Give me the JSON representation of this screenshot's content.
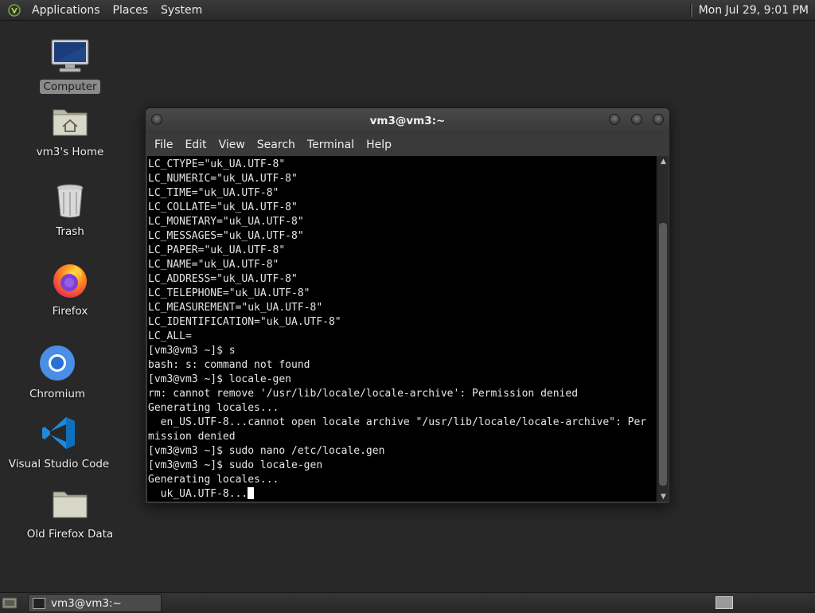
{
  "top_panel": {
    "menus": [
      "Applications",
      "Places",
      "System"
    ],
    "clock": "Mon Jul 29,  9:01 PM"
  },
  "desktop": {
    "icons": [
      {
        "label": "Computer",
        "icon": "computer-icon",
        "selected": true
      },
      {
        "label": "vm3's Home",
        "icon": "home-folder-icon"
      },
      {
        "label": "Trash",
        "icon": "trash-icon"
      },
      {
        "label": "Firefox",
        "icon": "firefox-icon"
      },
      {
        "label": "Chromium",
        "icon": "chromium-icon"
      },
      {
        "label": "Visual Studio Code",
        "icon": "vscode-icon"
      },
      {
        "label": "Old Firefox Data",
        "icon": "folder-icon"
      }
    ]
  },
  "terminal": {
    "title": "vm3@vm3:~",
    "menus": [
      "File",
      "Edit",
      "View",
      "Search",
      "Terminal",
      "Help"
    ],
    "lines": [
      "LC_CTYPE=\"uk_UA.UTF-8\"",
      "LC_NUMERIC=\"uk_UA.UTF-8\"",
      "LC_TIME=\"uk_UA.UTF-8\"",
      "LC_COLLATE=\"uk_UA.UTF-8\"",
      "LC_MONETARY=\"uk_UA.UTF-8\"",
      "LC_MESSAGES=\"uk_UA.UTF-8\"",
      "LC_PAPER=\"uk_UA.UTF-8\"",
      "LC_NAME=\"uk_UA.UTF-8\"",
      "LC_ADDRESS=\"uk_UA.UTF-8\"",
      "LC_TELEPHONE=\"uk_UA.UTF-8\"",
      "LC_MEASUREMENT=\"uk_UA.UTF-8\"",
      "LC_IDENTIFICATION=\"uk_UA.UTF-8\"",
      "LC_ALL=",
      "[vm3@vm3 ~]$ s",
      "bash: s: command not found",
      "[vm3@vm3 ~]$ locale-gen",
      "rm: cannot remove '/usr/lib/locale/locale-archive': Permission denied",
      "Generating locales...",
      "  en_US.UTF-8...cannot open locale archive \"/usr/lib/locale/locale-archive\": Per",
      "mission denied",
      "[vm3@vm3 ~]$ sudo nano /etc/locale.gen",
      "[vm3@vm3 ~]$ sudo locale-gen",
      "Generating locales...",
      "  uk_UA.UTF-8..."
    ]
  },
  "taskbar": {
    "task_label": "vm3@vm3:~"
  }
}
